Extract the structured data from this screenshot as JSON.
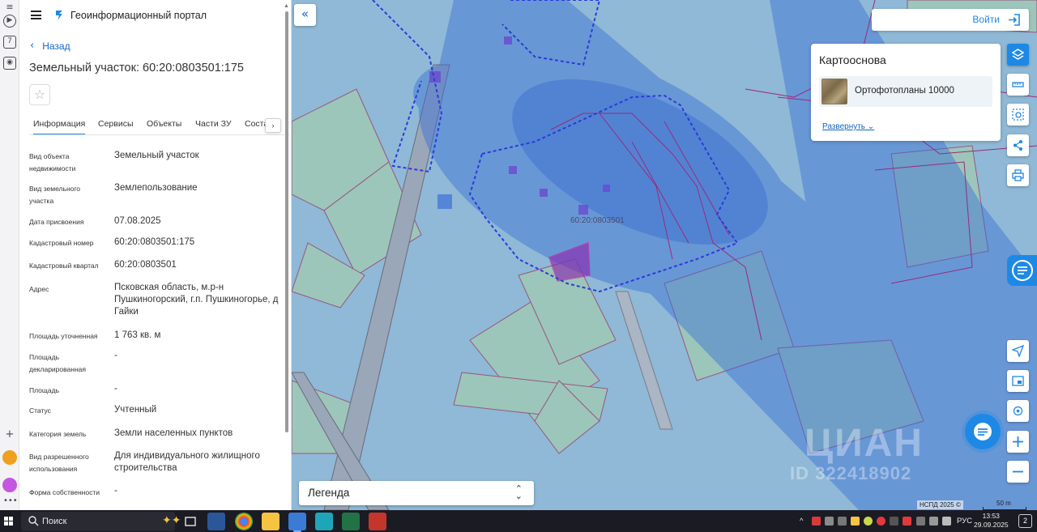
{
  "header": {
    "portal_title": "Геоинформационный портал"
  },
  "navigation": {
    "back_label": "Назад"
  },
  "parcel": {
    "title": "Земельный участок: 60:20:0803501:175"
  },
  "tabs": [
    "Информация",
    "Сервисы",
    "Объекты",
    "Части ЗУ",
    "Соста"
  ],
  "attributes": [
    {
      "label": "Вид объекта недвижимости",
      "value": "Земельный участок"
    },
    {
      "label": "Вид земельного участка",
      "value": "Землепользование"
    },
    {
      "label": "Дата присвоения",
      "value": "07.08.2025"
    },
    {
      "label": "Кадастровый номер",
      "value": "60:20:0803501:175"
    },
    {
      "label": "Кадастровый квартал",
      "value": "60:20:0803501"
    },
    {
      "label": "Адрес",
      "value": "Псковская область, м.р-н Пушкиногорский, г.п. Пушкиногорье, д Гайки"
    },
    {
      "label": "Площадь уточненная",
      "value": "1 763 кв. м"
    },
    {
      "label": "Площадь декларированная",
      "value": "-"
    },
    {
      "label": "Площадь",
      "value": "-"
    },
    {
      "label": "Статус",
      "value": "Учтенный"
    },
    {
      "label": "Категория земель",
      "value": "Земли населенных пунктов"
    },
    {
      "label": "Вид разрешенного использования",
      "value": "Для индивидуального жилищного строительства"
    },
    {
      "label": "Форма собственности",
      "value": "-"
    }
  ],
  "map": {
    "quarter_label": "60:20:0803501",
    "login_label": "Войти",
    "basemap": {
      "title": "Картооснова",
      "item": "Ортофотопланы 10000",
      "expand_label": "Развернуть"
    },
    "legend_label": "Легенда",
    "attribution": "НСПД 2025 ©",
    "scale_label": "50 m",
    "watermark_brand": "ЦИАН",
    "watermark_id": "ID 322418902",
    "tools": [
      "layers-icon",
      "ruler-icon",
      "select-area-icon",
      "share-icon",
      "print-icon",
      "locate-icon",
      "minimap-icon",
      "geolocation-icon",
      "zoom-in-icon",
      "zoom-out-icon"
    ]
  },
  "taskbar": {
    "search_label": "Поиск",
    "language": "РУС",
    "time": "13:53",
    "date": "29.09.2025",
    "notifications": "2"
  },
  "colors": {
    "accent": "#1e88e5",
    "map_base": "#8fb9d6",
    "zone_overlay": "#3a6fd8",
    "parcel_outline": "#a0286e",
    "taskbar": "#1b1b24"
  }
}
